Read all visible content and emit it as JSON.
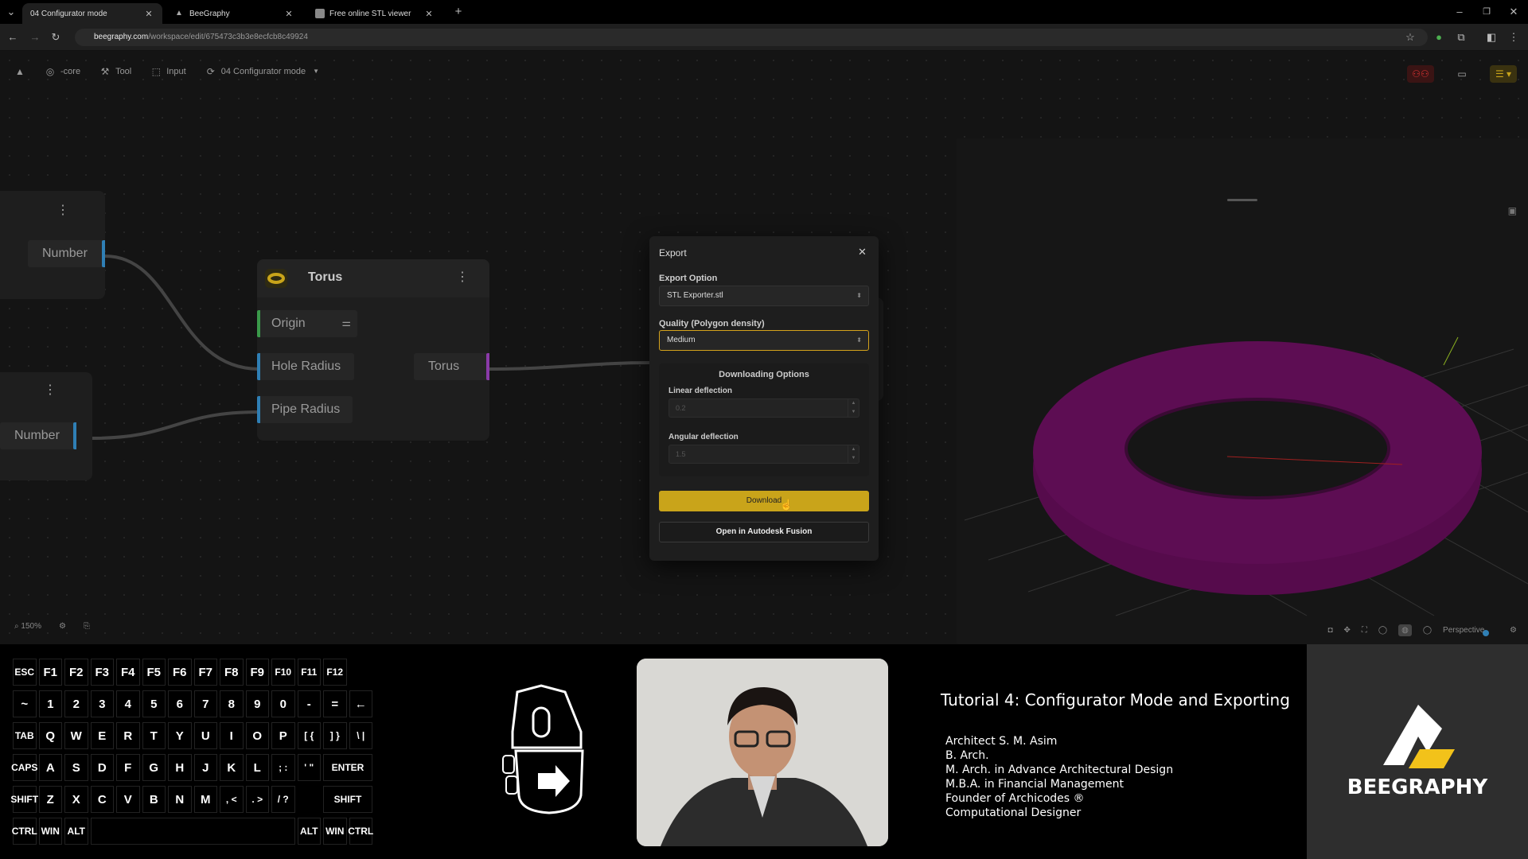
{
  "browser": {
    "tabs": [
      {
        "label": "04 Configurator mode",
        "active": true
      },
      {
        "label": "BeeGraphy",
        "active": false
      },
      {
        "label": "Free online STL viewer",
        "active": false
      }
    ],
    "new_tab": "+",
    "url_host": "beegraphy.com",
    "url_path": "/workspace/edit/675473c3b3e8ecfcb8c49924"
  },
  "app": {
    "toolbar": {
      "core_label": "-core",
      "tool_label": "Tool",
      "input_label": "Input",
      "mode_label": "04 Configurator mode"
    },
    "zoom": "150%",
    "viewport": {
      "camera_label": "Perspective",
      "torus_color": "#5a0a4a"
    }
  },
  "nodes": {
    "number_top": {
      "output_label": "Number"
    },
    "number_bottom": {
      "output_label": "Number"
    },
    "torus": {
      "title": "Torus",
      "inputs": [
        "Origin",
        "Hole Radius",
        "Pipe Radius"
      ],
      "output": "Torus"
    }
  },
  "export_dialog": {
    "title": "Export",
    "export_option_label": "Export Option",
    "export_option_value": "STL Exporter.stl",
    "quality_label": "Quality (Polygon density)",
    "quality_value": "Medium",
    "downloading_options_label": "Downloading Options",
    "linear_deflection_label": "Linear deflection",
    "linear_deflection_value": "0.2",
    "angular_deflection_label": "Angular deflection",
    "angular_deflection_value": "1.5",
    "download_label": "Download",
    "fusion_label": "Open in Autodesk Fusion"
  },
  "colors": {
    "accent": "#c9a41a",
    "port_blue": "#2f7fb5",
    "port_green": "#3a9a4a",
    "port_purple": "#8a3aa8"
  },
  "keyboard": {
    "rows": [
      [
        "ESC",
        "F1",
        "F2",
        "F3",
        "F4",
        "F5",
        "F6",
        "F7",
        "F8",
        "F9",
        "F10",
        "F11",
        "F12"
      ],
      [
        "~",
        "1",
        "2",
        "3",
        "4",
        "5",
        "6",
        "7",
        "8",
        "9",
        "0",
        "-",
        "=",
        "←"
      ],
      [
        "TAB",
        "Q",
        "W",
        "E",
        "R",
        "T",
        "Y",
        "U",
        "I",
        "O",
        "P",
        "[ {",
        "] }",
        "\\ |"
      ],
      [
        "CAPS",
        "A",
        "S",
        "D",
        "F",
        "G",
        "H",
        "J",
        "K",
        "L",
        "; :",
        "' \"",
        "ENTER"
      ],
      [
        "SHIFT",
        "Z",
        "X",
        "C",
        "V",
        "B",
        "N",
        "M",
        ", <",
        ". >",
        "/ ?",
        "SHIFT"
      ],
      [
        "CTRL",
        "WIN",
        "ALT",
        "",
        "ALT",
        "WIN",
        "CTRL"
      ]
    ]
  },
  "tutorial": {
    "title": "Tutorial 4: Configurator Mode and Exporting",
    "bio": [
      "Architect S. M. Asim",
      "B. Arch.",
      "M. Arch. in Advance Architectural Design",
      "M.B.A. in Financial Management",
      "Founder of Archicodes ®",
      "Computational Designer"
    ],
    "brand": "BEEGRAPHY"
  }
}
